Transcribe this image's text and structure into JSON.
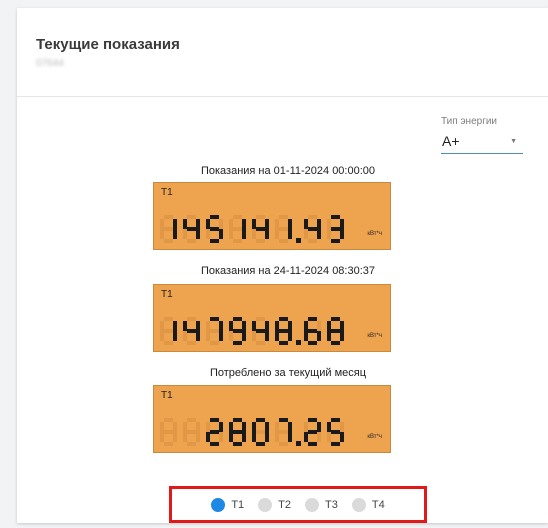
{
  "header": {
    "title": "Текущие показания",
    "subtitle": "07644"
  },
  "energy": {
    "label": "Тип энергии",
    "value": "A+"
  },
  "readings": [
    {
      "label": "Показания на 01-11-2024 00:00:00",
      "tariff": "T1",
      "display": "145 141.43",
      "ghost": "888888.88",
      "unit": "кВт*ч"
    },
    {
      "label": "Показания на 24-11-2024 08:30:37",
      "tariff": "T1",
      "display": "147948.68",
      "ghost": "888888.88",
      "unit": "кВт*ч"
    },
    {
      "label": "Потреблено за текущий месяц",
      "tariff": "T1",
      "display": "2807.25",
      "ghost": "888888.88",
      "unit": "кВт*ч"
    }
  ],
  "tariffs": [
    {
      "label": "T1",
      "selected": true
    },
    {
      "label": "T2",
      "selected": false
    },
    {
      "label": "T3",
      "selected": false
    },
    {
      "label": "T4",
      "selected": false
    }
  ],
  "colors": {
    "lcd_bg": "#eea34f",
    "accent": "#1e88e5",
    "highlight": "#e11919"
  }
}
